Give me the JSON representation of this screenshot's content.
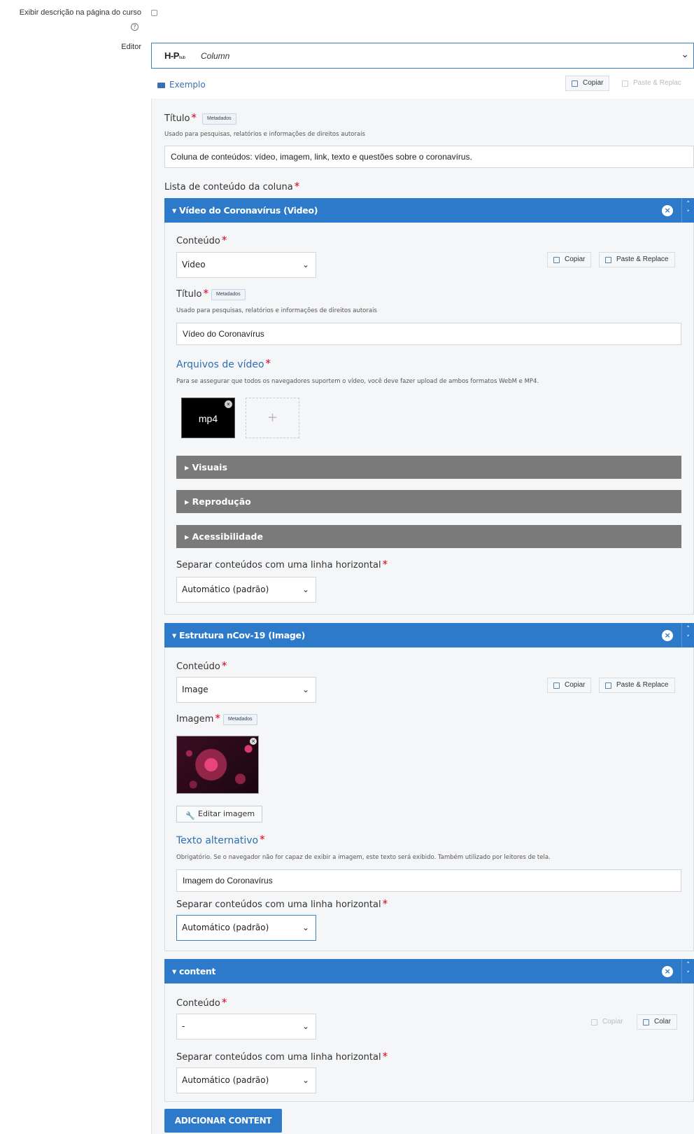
{
  "top": {
    "show_description_label": "Exibir descrição na página do curso",
    "editor_label": "Editor",
    "editor_logo": "H-P",
    "editor_logo_sub": "hub",
    "editor_value": "Column",
    "example_link": "Exemplo",
    "copy_label": "Copiar",
    "paste_label": "Paste & Replac"
  },
  "main": {
    "title_label": "Título",
    "metadata_label": "Metadados",
    "title_desc": "Usado para pesquisas, relatórios e informações de direitos autorais",
    "title_value": "Coluna de conteúdos: vídeo, imagem, link, texto e questões sobre o coronavírus.",
    "list_label": "Lista de conteúdo da coluna"
  },
  "video_group": {
    "header": "Vídeo do Coronavírus (Video)",
    "content_label": "Conteúdo",
    "content_value": "Video",
    "copy_label": "Copiar",
    "paste_label": "Paste & Replace",
    "title_label": "Título",
    "metadata_label": "Metadados",
    "title_desc": "Usado para pesquisas, relatórios e informações de direitos autorais",
    "title_value": "Vídeo do Coronavírus",
    "files_label": "Arquivos de vídeo",
    "files_desc": "Para se assegurar que todos os navegadores suportem o vídeo, você deve fazer upload de ambos formatos WebM e MP4.",
    "file_name": "mp4",
    "section_visuals": "Visuais",
    "section_playback": "Reprodução",
    "section_accessibility": "Acessibilidade",
    "separator_label": "Separar conteúdos com uma linha horizontal",
    "separator_value": "Automático (padrão)"
  },
  "image_group": {
    "header": "Estrutura nCov-19 (Image)",
    "content_label": "Conteúdo",
    "content_value": "Image",
    "copy_label": "Copiar",
    "paste_label": "Paste & Replace",
    "image_label": "Imagem",
    "metadata_label": "Metadados",
    "edit_image_label": "Editar imagem",
    "alt_label": "Texto alternativo",
    "alt_desc": "Obrigatório. Se o navegador não for capaz de exibir a imagem, este texto será exibido. Também utilizado por leitores de tela.",
    "alt_value": "Imagem do Coronavírus",
    "separator_label": "Separar conteúdos com uma linha horizontal",
    "separator_value": "Automático (padrão)"
  },
  "content_group": {
    "header": "content",
    "content_label": "Conteúdo",
    "content_value": "-",
    "copy_label": "Copiar",
    "paste_label": "Colar",
    "separator_label": "Separar conteúdos com uma linha horizontal",
    "separator_value": "Automático (padrão)"
  },
  "add_button": "ADICIONAR CONTENT",
  "colors": {
    "accent": "#2c7ac9",
    "required": "#d9001b",
    "section_bar": "#7a7a7a"
  }
}
